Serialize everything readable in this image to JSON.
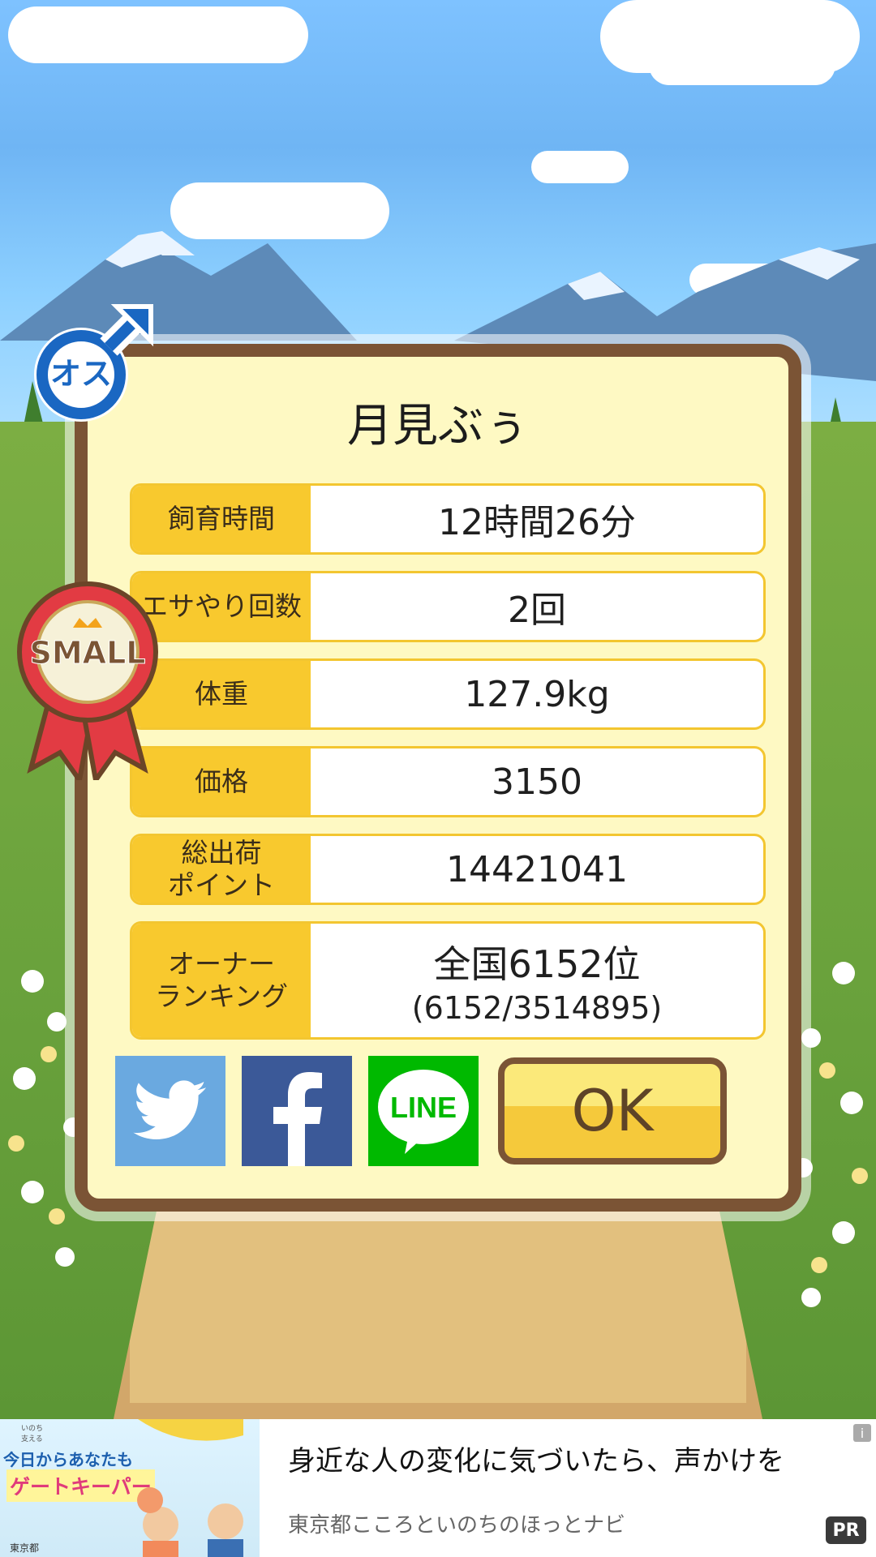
{
  "pet": {
    "name": "月見ぶぅ"
  },
  "gender_badge": {
    "text": "オス"
  },
  "size_badge": {
    "text": "SMALL"
  },
  "stats": [
    {
      "label": "飼育時間",
      "value": "12時間26分"
    },
    {
      "label": "エサやり回数",
      "value": "2回"
    },
    {
      "label": "体重",
      "value": "127.9kg"
    },
    {
      "label": "価格",
      "value": "3150"
    },
    {
      "label": "総出荷\nポイント",
      "value": "14421041"
    }
  ],
  "ranking": {
    "label": "オーナー\nランキング",
    "line1": "全国6152位",
    "line2": "(6152/3514895)"
  },
  "share": {
    "twitter": "twitter",
    "facebook": "facebook",
    "line": "LINE"
  },
  "ok_button": {
    "label": "OK"
  },
  "ad": {
    "title": "身近な人の変化に気づいたら、声かけを",
    "subtitle": "東京都こころといのちのほっとナビ",
    "pr": "PR",
    "info": "i",
    "image_caption": "今日からあなたも",
    "image_headline": "ゲートキーパー",
    "image_small_top": "いのち\n支える",
    "image_bottom": "東京都"
  }
}
